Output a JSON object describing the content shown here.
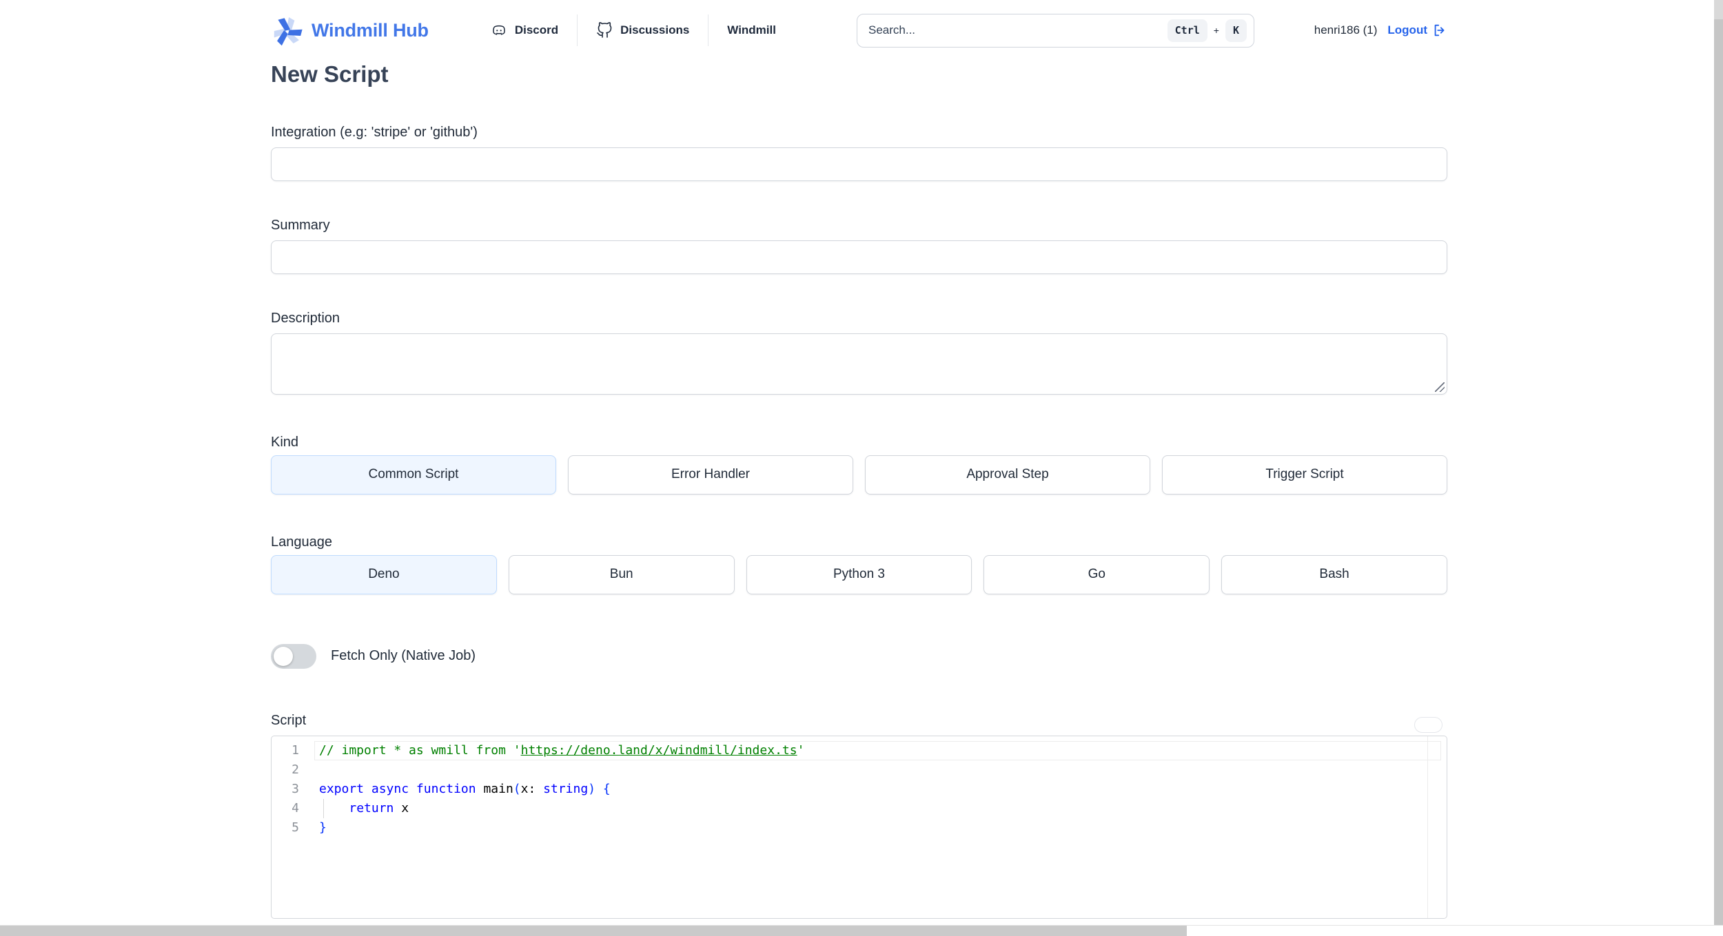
{
  "header": {
    "brand": "Windmill Hub",
    "brand_color": "#4277e8",
    "nav": [
      {
        "label": "Discord",
        "icon": "discord-icon"
      },
      {
        "label": "Discussions",
        "icon": "github-icon"
      },
      {
        "label": "Windmill",
        "icon": null
      }
    ],
    "search": {
      "placeholder": "Search...",
      "keys": [
        "Ctrl",
        "K"
      ],
      "plus": "+"
    },
    "user": "henri186 (1)",
    "logout_label": "Logout",
    "logout_color": "#2563eb"
  },
  "page": {
    "title": "New Script"
  },
  "form": {
    "integration": {
      "label": "Integration (e.g: 'stripe' or 'github')",
      "value": "",
      "placeholder": ""
    },
    "summary": {
      "label": "Summary",
      "value": "",
      "placeholder": ""
    },
    "description": {
      "label": "Description",
      "value": "",
      "placeholder": ""
    },
    "kind": {
      "label": "Kind",
      "options": [
        "Common Script",
        "Error Handler",
        "Approval Step",
        "Trigger Script"
      ],
      "selected": "Common Script",
      "selected_bg": "#eff6ff"
    },
    "language": {
      "label": "Language",
      "options": [
        "Deno",
        "Bun",
        "Python 3",
        "Go",
        "Bash"
      ],
      "selected": "Deno",
      "selected_bg": "#eff6ff"
    },
    "fetch_only": {
      "label": "Fetch Only (Native Job)",
      "enabled": false
    },
    "script": {
      "label": "Script"
    }
  },
  "editor": {
    "active_line": "1",
    "token_colors": {
      "comment": "#008000",
      "comment-link": "#008000",
      "keyword": "#0000ff",
      "plain": "#000000",
      "bracket": "#0431fa",
      "line-number": "#8c9198"
    },
    "lines": [
      {
        "number": "1",
        "active": true,
        "tokens": [
          [
            "comment",
            "// import * as wmill from '"
          ],
          [
            "comment-link",
            "https://deno.land/x/windmill/index.ts"
          ],
          [
            "comment",
            "'"
          ]
        ]
      },
      {
        "number": "2",
        "tokens": []
      },
      {
        "number": "3",
        "tokens": [
          [
            "keyword",
            "export"
          ],
          [
            "plain",
            " "
          ],
          [
            "keyword",
            "async"
          ],
          [
            "plain",
            " "
          ],
          [
            "keyword",
            "function"
          ],
          [
            "plain",
            " main"
          ],
          [
            "bracket",
            "("
          ],
          [
            "plain",
            "x: "
          ],
          [
            "keyword",
            "string"
          ],
          [
            "bracket",
            ")"
          ],
          [
            "plain",
            " "
          ],
          [
            "bracket",
            "{"
          ]
        ]
      },
      {
        "number": "4",
        "indent_guide": true,
        "tokens": [
          [
            "plain",
            "    "
          ],
          [
            "keyword",
            "return"
          ],
          [
            "plain",
            " x"
          ]
        ]
      },
      {
        "number": "5",
        "tokens": [
          [
            "bracket",
            "}"
          ]
        ]
      }
    ]
  }
}
